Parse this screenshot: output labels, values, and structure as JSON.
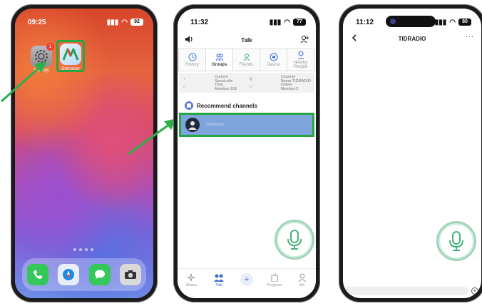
{
  "colors": {
    "highlight_green": "#26a744",
    "selected_row": "#7ea4dc",
    "accent_blue": "#3d6dd6",
    "mic_ring": "#9fd4b9"
  },
  "phone1": {
    "time": "09:25",
    "battery": "92",
    "settings_label": "Settings",
    "settings_badge": "1",
    "app_label": "Odmaster",
    "dock_icons": [
      "phone-icon",
      "safari-icon",
      "messages-icon",
      "camera-icon"
    ]
  },
  "phone2": {
    "time": "11:32",
    "battery": "77",
    "title": "Talk",
    "tabs": [
      {
        "label": "History",
        "icon": "clock-icon"
      },
      {
        "label": "Groups",
        "icon": "group-icon"
      },
      {
        "label": "Friends",
        "icon": "friend-icon"
      },
      {
        "label": "Device",
        "icon": "device-icon"
      },
      {
        "label": "Nearby People",
        "icon": "location-person-icon"
      }
    ],
    "info": {
      "current_speaker": "Current Speak:idle",
      "channel_name": "Channel Name:TIDRADIO",
      "total_member": "Total Member:108",
      "online_member": "Online Member:2"
    },
    "section_title": "Recommend channels",
    "channel_name": "TIDRADIO",
    "nav": [
      {
        "label": "Status",
        "icon": "status-icon"
      },
      {
        "label": "Talk",
        "icon": "talk-icon"
      },
      {
        "label": "",
        "icon": "plus-icon"
      },
      {
        "label": "Program",
        "icon": "program-icon"
      },
      {
        "label": "Me",
        "icon": "person-icon"
      }
    ]
  },
  "phone3": {
    "time": "11:12",
    "battery": "80",
    "title": "TIDRADIO",
    "more": "···"
  }
}
